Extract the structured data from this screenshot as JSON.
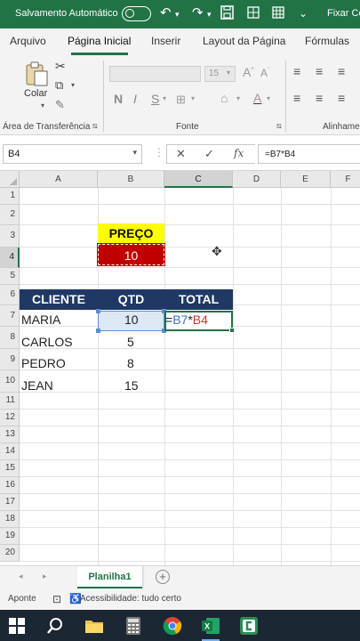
{
  "titlebar": {
    "autosave_label": "Salvamento Automático",
    "pin_label": "Fixar Cé"
  },
  "ribbon_tabs": [
    "Arquivo",
    "Página Inicial",
    "Inserir",
    "Layout da Página",
    "Fórmulas"
  ],
  "ribbon": {
    "paste_label": "Colar",
    "font_size": "15",
    "group_clipboard": "Área de Transferência",
    "group_font": "Fonte",
    "group_align": "Alinhame",
    "bold": "N",
    "italic": "I",
    "underline": "S"
  },
  "formula_bar": {
    "name_box": "B4",
    "formula": "=B7*B4",
    "fx": "fx"
  },
  "columns": [
    "A",
    "B",
    "C",
    "D",
    "E",
    "F"
  ],
  "rows": [
    "1",
    "2",
    "3",
    "4",
    "5",
    "6",
    "7",
    "8",
    "9",
    "10",
    "11",
    "12",
    "13",
    "14",
    "15",
    "16",
    "17",
    "18",
    "19",
    "20"
  ],
  "cells": {
    "preco_label": "PREÇO",
    "preco_value": "10",
    "header_cliente": "CLIENTE",
    "header_qtd": "QTD",
    "header_total": "TOTAL",
    "formula_eq": "=",
    "formula_ref1": "B7",
    "formula_op": "*",
    "formula_ref2": "B4",
    "data": [
      {
        "cliente": "MARIA",
        "qtd": "10"
      },
      {
        "cliente": "CARLOS",
        "qtd": "5"
      },
      {
        "cliente": "PEDRO",
        "qtd": "8"
      },
      {
        "cliente": "JEAN",
        "qtd": "15"
      }
    ]
  },
  "sheet_tab": "Planilha1",
  "status": {
    "mode": "Aponte",
    "accessibility": "Acessibilidade: tudo certo"
  },
  "colors": {
    "excel_green": "#217346",
    "header_navy": "#1f3864",
    "preco_yellow": "#ffff00",
    "preco_red": "#c00000",
    "ref_blue": "#3c6fd0",
    "ref_red": "#c0392b"
  }
}
